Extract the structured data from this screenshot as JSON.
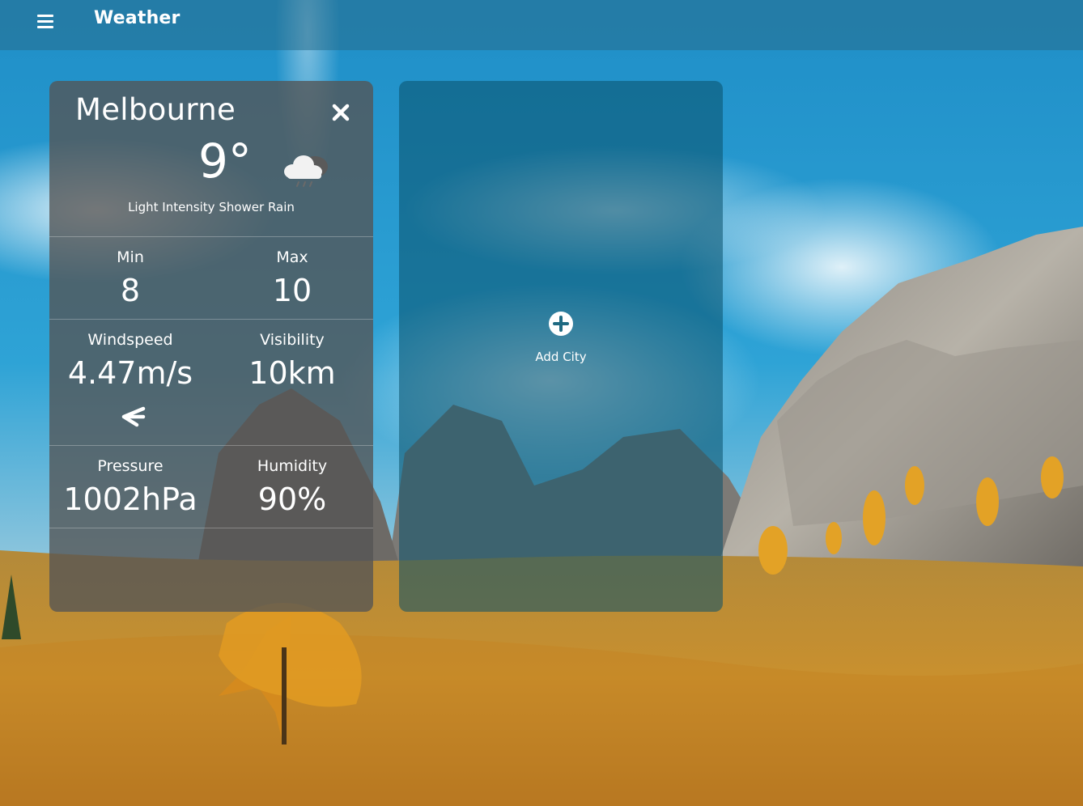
{
  "app": {
    "title": "Weather",
    "menu_icon": "hamburger-menu-icon"
  },
  "city_card": {
    "city": "Melbourne",
    "temperature": "9°",
    "weather_icon": "cloud-rain-icon",
    "description": "Light Intensity Shower Rain",
    "close_icon": "close-icon",
    "stats": {
      "min_label": "Min",
      "min_value": "8",
      "max_label": "Max",
      "max_value": "10",
      "windspeed_label": "Windspeed",
      "windspeed_value": "4.47m/s",
      "wind_direction_icon": "arrow-left-icon",
      "visibility_label": "Visibility",
      "visibility_value": "10km",
      "pressure_label": "Pressure",
      "pressure_value": "1002hPa",
      "humidity_label": "Humidity",
      "humidity_value": "90%"
    }
  },
  "add_city_card": {
    "icon": "plus-circle-icon",
    "label": "Add City"
  },
  "colors": {
    "appbar": "#2f7a98",
    "weather_card": "#555555",
    "add_card": "#0a5069",
    "text": "#ffffff"
  }
}
